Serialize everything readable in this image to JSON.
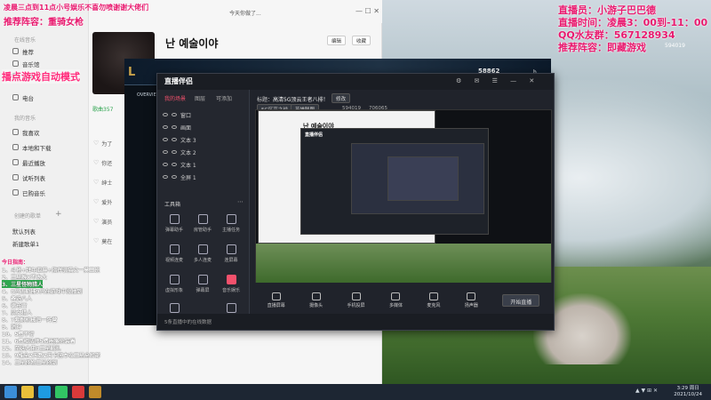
{
  "overlay": {
    "top_left_line1": "凌晨三点到11点小号娱乐不喜勿喷谢谢大佬们",
    "top_left_line2": "推荐阵容：重骑女枪",
    "mid_left_banner": "播点游戏自动模式",
    "right_line1": "直播员：小游子巴巴德",
    "right_line2": "直播时间：凌晨3：00到-11：00",
    "right_line3": "QQ水友群：567128934",
    "right_line4": "推荐阵容：即藏游戏"
  },
  "music_app": {
    "window_title": "今天你做了...",
    "song_title": "난 예술이야",
    "btn_edit": "编辑",
    "btn_collect": "收藏",
    "sidebar": {
      "section1": "在线音乐",
      "items1": [
        "推荐",
        "音乐馆",
        "视频",
        "电台"
      ],
      "section2": "我的音乐",
      "items2": [
        "我喜欢",
        "本地和下载",
        "最近播放",
        "试听列表",
        "已购音乐"
      ],
      "section3": "创建的歌单",
      "items3": [
        "默认列表",
        "新建歌单1"
      ]
    },
    "tracks": [
      "为了",
      "你还",
      "绅士",
      "爱外",
      "演员",
      "莫在"
    ],
    "play_count": "歌曲357"
  },
  "game": {
    "banner_text": "OVERVIEW",
    "player_count": "58862",
    "army_label": "h army",
    "id_number": "594019"
  },
  "stream_app": {
    "logo": "直播伴侣",
    "tabs": [
      "我的场景",
      "图层",
      "可添加"
    ],
    "title_label": "标题：",
    "title_value": "高清5G顶云王者八排！",
    "tag_btn": "修改",
    "sub_tag1": "5G区高之战",
    "sub_tag2": "英雄联盟",
    "room_id": "594019",
    "fans": "706065",
    "layers": [
      "窗口",
      "画面",
      "文本 3",
      "文本 2",
      "文本 1",
      "全屏 1"
    ],
    "tools_header": "工具箱",
    "tools": [
      "弹幕助手",
      "房管助手",
      "主播任务",
      "视频连麦",
      "多人连麦",
      "连屏幕",
      "虚拟形象",
      "弹幕屏",
      "音乐娱乐",
      "礼物",
      "美颜"
    ],
    "bottom_controls": [
      "直播屏幕",
      "摄像头",
      "手机投屏",
      "多媒体",
      "麦克风",
      "扬声器"
    ],
    "go_live": "开始直播",
    "status_text": "5条直播中的在线数据"
  },
  "chat": {
    "header": "今日指南：",
    "lines": [
      "1、斗将+拜年亚麻+指挥驯猫文一莫三班",
      "2、三星猴X不太大",
      "3、三星怪物猎人",
      "4、8只古斯捕9只在游戏中没抽到",
      "5、备选八人",
      "6、德布雷",
      "7、灵女猎人",
      "8、7紫耐机械海一阵营",
      "9、消神",
      "10、5费不行",
      "11、6费相法师5费圈猴杀装着",
      "12、至选大佬3三星贼扎",
      "13、9推全2天数2天卡区本攻三星全和部",
      "14、三星怪物三星创剑"
    ]
  },
  "taskbar": {
    "time": "3:29 周日",
    "date": "2021/10/24",
    "right_tag": "▲ ▼ ⊞ ✕"
  },
  "colors": {
    "overlay_pink": "#e8196e",
    "stream_bg": "#20232b",
    "taskbar_bg": "#1d2633"
  }
}
